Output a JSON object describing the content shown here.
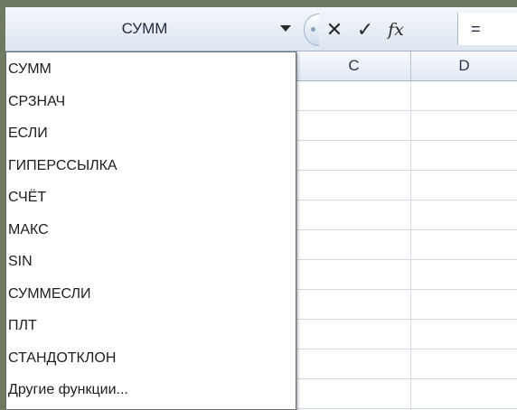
{
  "formula_bar": {
    "name_box_value": "СУММ",
    "formula_value": "="
  },
  "icons": {
    "cancel": "close-icon",
    "enter": "checkmark-icon",
    "insert_function": "fx-icon",
    "dropdown": "chevron-down-icon"
  },
  "buttons": {
    "cancel_glyph": "✕",
    "enter_glyph": "✓",
    "fx_label": "fx"
  },
  "columns": [
    "C",
    "D"
  ],
  "function_list": [
    "СУММ",
    "СРЗНАЧ",
    "ЕСЛИ",
    "ГИПЕРССЫЛКА",
    "СЧЁТ",
    "МАКС",
    "SIN",
    "СУММЕСЛИ",
    "ПЛТ",
    "СТАНДОТКЛОН",
    "Другие функции..."
  ],
  "colors": {
    "background": "#6f7a63",
    "header_text": "#283a52"
  }
}
